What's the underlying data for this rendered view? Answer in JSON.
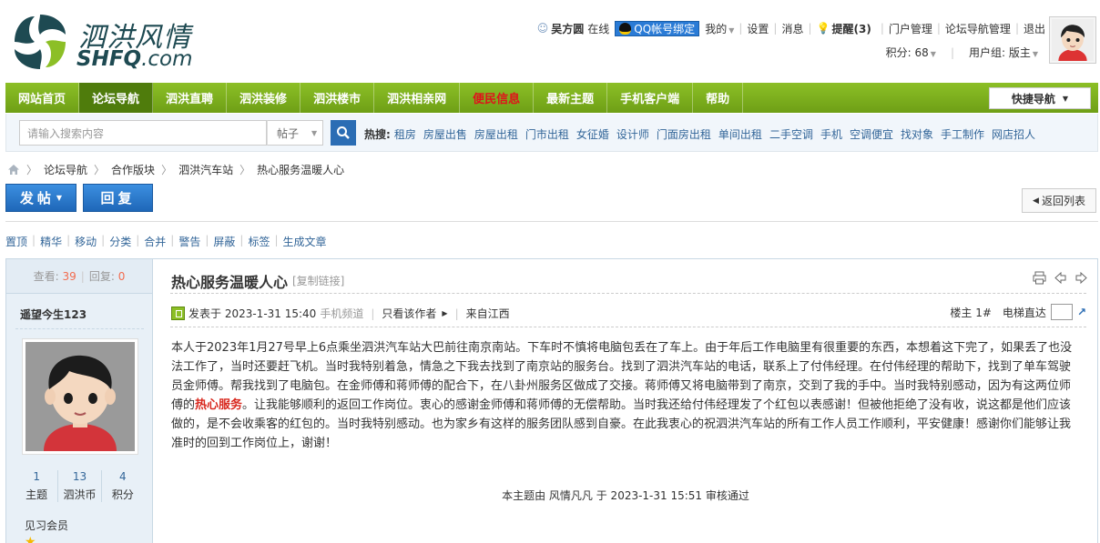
{
  "logo": {
    "cn": "泗洪风情",
    "en_main": "SHFQ",
    "en_suffix": ".com"
  },
  "user": {
    "name": "吴方圆",
    "status": "在线",
    "qq_bind": "QQ帐号绑定",
    "links": [
      "我的",
      "设置",
      "消息"
    ],
    "remind": "提醒(3)",
    "admin_links": [
      "门户管理",
      "论坛导航管理",
      "退出"
    ],
    "points": "积分: 68",
    "group": "用户组: 版主"
  },
  "nav": {
    "items": [
      "网站首页",
      "论坛导航",
      "泗洪直聘",
      "泗洪装修",
      "泗洪楼市",
      "泗洪相亲网",
      "便民信息",
      "最新主题",
      "手机客户端",
      "帮助"
    ],
    "quick": "快捷导航"
  },
  "search": {
    "placeholder": "请输入搜索内容",
    "type": "帖子",
    "hot_label": "热搜:",
    "hot": [
      "租房",
      "房屋出售",
      "房屋出租",
      "门市出租",
      "女征婚",
      "设计师",
      "门面房出租",
      "单间出租",
      "二手空调",
      "手机",
      "空调便宜",
      "找对象",
      "手工制作",
      "网店招人"
    ]
  },
  "breadcrumb": [
    "论坛导航",
    "合作版块",
    "泗洪汽车站",
    "热心服务温暖人心"
  ],
  "actions": {
    "post": "发帖",
    "reply": "回复",
    "back": "返回列表"
  },
  "mod": [
    "置顶",
    "精华",
    "移动",
    "分类",
    "合并",
    "警告",
    "屏蔽",
    "标签",
    "生成文章"
  ],
  "thread": {
    "views_label": "查看:",
    "views": "39",
    "replies_label": "回复:",
    "replies": "0",
    "title": "热心服务温暖人心",
    "copy_link": "[复制链接]"
  },
  "author": {
    "name": "遥望今生123",
    "stats": [
      {
        "v": "1",
        "l": "主题"
      },
      {
        "v": "13",
        "l": "泗洪币"
      },
      {
        "v": "4",
        "l": "积分"
      }
    ],
    "level": "见习会员"
  },
  "post": {
    "posted": "发表于 2023-1-31 15:40",
    "via": "手机频道",
    "only_author": "只看该作者",
    "from": "来自江西",
    "floor": "楼主 1#",
    "elevator": "电梯直达",
    "body_1": "本人于2023年1月27号早上6点乘坐泗洪汽车站大巴前往南京南站。下车时不慎将电脑包丢在了车上。由于年后工作电脑里有很重要的东西，本想着这下完了，如果丢了也没法工作了，当时还要赶飞机。当时我特别着急，情急之下我去找到了南京站的服务台。找到了泗洪汽车站的电话，联系上了付伟经理。在付伟经理的帮助下，找到了单车驾驶员金师傅。帮我找到了电脑包。在金师傅和蒋师傅的配合下，在八卦州服务区做成了交接。蒋师傅又将电脑带到了南京，交到了我的手中。当时我特别感动，因为有这两位师傅的",
    "body_hl": "热心服务",
    "body_2": "。让我能够顺利的返回工作岗位。衷心的感谢金师傅和蒋师傅的无偿帮助。当时我还给付伟经理发了个红包以表感谢！但被他拒绝了没有收，说这都是他们应该做的，是不会收乘客的红包的。当时我特别感动。也为家乡有这样的服务团队感到自豪。在此我衷心的祝泗洪汽车站的所有工作人员工作顺利，平安健康！感谢你们能够让我准时的回到工作岗位上，谢谢！",
    "audit": "本主题由 风情凡凡 于 2023-1-31 15:51 审核通过"
  },
  "colors": {
    "nav_green": "#7cad1c",
    "nav_active": "#4f7c0c",
    "link_blue": "#336699",
    "btn_blue": "#2b6db4",
    "highlight_red": "#d8281e"
  }
}
